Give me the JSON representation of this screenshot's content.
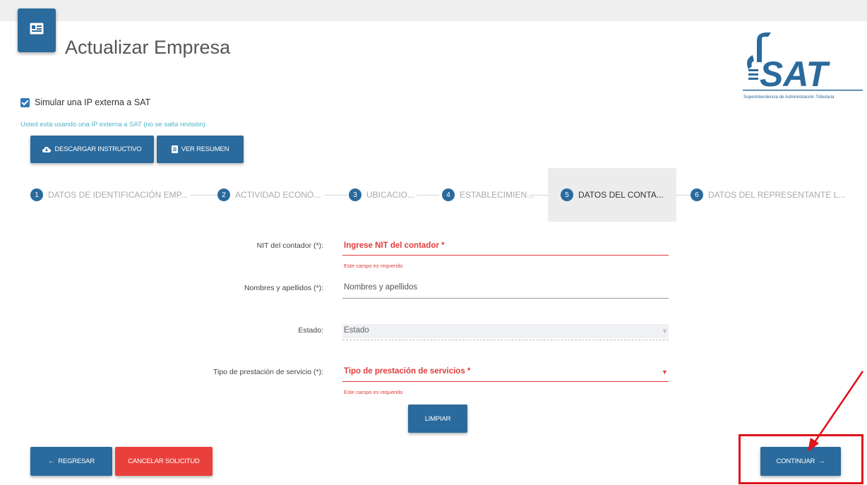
{
  "header": {
    "title": "Actualizar Empresa",
    "logo_text": "SAT",
    "logo_subtitle": "Superintendencia de Administración Tributaria"
  },
  "simulate": {
    "label": "Simular una IP externa a SAT",
    "checked": true,
    "note": "Usted está usando una IP externa a SAT (no se salta revisión)"
  },
  "actions": {
    "download_label": "DESCARGAR INSTRUCTIVO",
    "summary_label": "VER RESUMEN"
  },
  "steps": [
    {
      "num": "1",
      "label": "DATOS DE IDENTIFICACIÓN EMP..."
    },
    {
      "num": "2",
      "label": "ACTIVIDAD ECONÓ..."
    },
    {
      "num": "3",
      "label": "UBICACIO..."
    },
    {
      "num": "4",
      "label": "ESTABLECIMIEN..."
    },
    {
      "num": "5",
      "label": "DATOS DEL CONTA...",
      "active": true
    },
    {
      "num": "6",
      "label": "DATOS DEL REPRESENTANTE L..."
    }
  ],
  "form": {
    "nit": {
      "label": "NIT del contador (*):",
      "placeholder": "Ingrese NIT del contador *",
      "error": "Este campo es requerido"
    },
    "names": {
      "label": "Nombres y apellidos (*):",
      "value": "Nombres y apellidos"
    },
    "state": {
      "label": "Estado:",
      "value": "Estado"
    },
    "service": {
      "label": "Tipo de prestación de servicio (*):",
      "placeholder": "Tipo de prestación de servicios *",
      "error": "Este campo es requerido"
    }
  },
  "buttons": {
    "clear": "LIMPIAR",
    "back": "REGRESAR",
    "cancel": "CANCELAR SOLICITUD",
    "continue": "CONTINUAR"
  },
  "colors": {
    "primary": "#2a6a9c",
    "danger": "#e9403b",
    "error_text": "#e23c3c",
    "highlight": "#e0121a",
    "note": "#4db4c9"
  }
}
